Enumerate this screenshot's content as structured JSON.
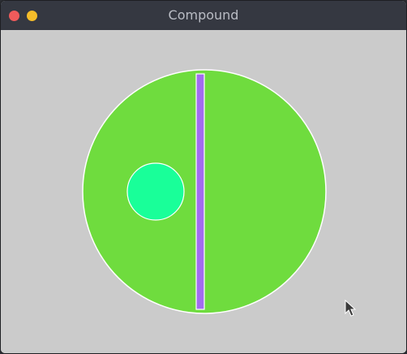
{
  "window": {
    "title": "Compound",
    "buttons": {
      "close_color": "#f05b5b",
      "minimize_color": "#f5bd2a"
    }
  },
  "canvas": {
    "background": "#cbcbcb",
    "shapes": {
      "big_circle": {
        "fill": "#6fdc3e",
        "stroke": "#ffffff"
      },
      "small_circle": {
        "fill": "#19ff99",
        "stroke": "#ffffff"
      },
      "bar": {
        "fill": "#a26cf0",
        "stroke": "#ffffff"
      }
    }
  },
  "cursor": {
    "icon": "arrow-pointer-icon",
    "color": "#3a3a3a"
  }
}
